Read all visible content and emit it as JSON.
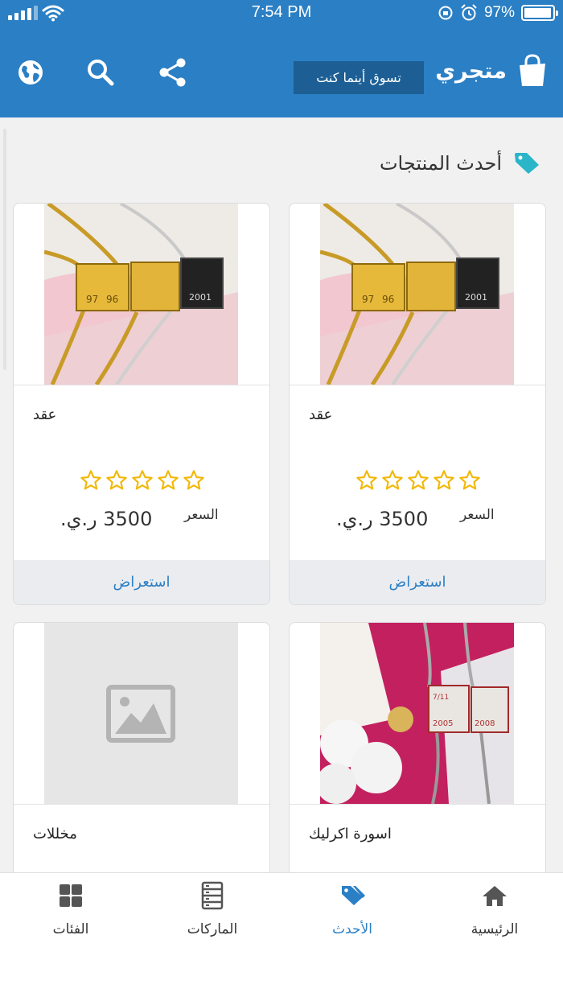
{
  "status_bar": {
    "time": "7:54 PM",
    "battery": "97%",
    "battery_level": 0.97
  },
  "header": {
    "title": "متجري",
    "tagline": "تسوق أينما كنت",
    "icons": [
      "bag-icon",
      "share-icon",
      "search-icon",
      "globe-icon"
    ]
  },
  "section": {
    "title": "أحدث المنتجات",
    "icon": "tag-icon"
  },
  "products": [
    {
      "name": "عقد",
      "rating": 0,
      "price_label": "السعر",
      "price": "3500 ر.ي.",
      "view_label": "استعراض",
      "image": "photo-necklaces"
    },
    {
      "name": "عقد",
      "rating": 0,
      "price_label": "السعر",
      "price": "3500 ر.ي.",
      "view_label": "استعراض",
      "image": "photo-necklaces"
    },
    {
      "name": "اسورة اكرليك",
      "image": "photo-bracelet"
    },
    {
      "name": "مخللات",
      "image": "image-placeholder-icon"
    }
  ],
  "bottom_nav": [
    {
      "label": "الرئيسية",
      "icon": "home-icon",
      "active": false
    },
    {
      "label": "الأحدث",
      "icon": "tags-icon",
      "active": true
    },
    {
      "label": "الماركات",
      "icon": "brands-list-icon",
      "active": false
    },
    {
      "label": "الفئات",
      "icon": "grid-icon",
      "active": false
    }
  ],
  "colors": {
    "primary": "#2b7fc4",
    "tagline_bg": "#1d5f95",
    "star": "#f2b705",
    "tag": "#2bb5c9"
  }
}
